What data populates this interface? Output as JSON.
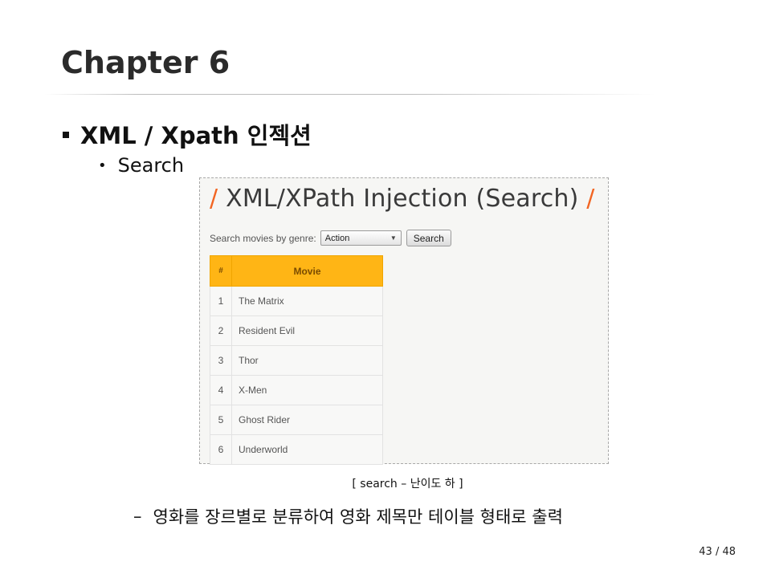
{
  "slide": {
    "title": "Chapter 6",
    "bullet1": "XML / Xpath 인젝션",
    "bullet2": "Search",
    "caption": "[ search – 난이도 하 ]",
    "description": "영화를 장르별로 분류하여 영화 제목만 테이블 형태로 출력",
    "page": "43 / 48"
  },
  "app": {
    "header_title": "XML/XPath Injection (Search)",
    "slash_glyph": "/",
    "search_label": "Search movies by genre:",
    "genre_selected": "Action",
    "search_button": "Search",
    "table_headers": [
      "#",
      "Movie"
    ],
    "rows": [
      {
        "num": "1",
        "title": "The Matrix"
      },
      {
        "num": "2",
        "title": "Resident Evil"
      },
      {
        "num": "3",
        "title": "Thor"
      },
      {
        "num": "4",
        "title": "X-Men"
      },
      {
        "num": "5",
        "title": "Ghost Rider"
      },
      {
        "num": "6",
        "title": "Underworld"
      }
    ]
  },
  "colors": {
    "accent_slash": "#f26522",
    "table_header": "#ffb515"
  }
}
